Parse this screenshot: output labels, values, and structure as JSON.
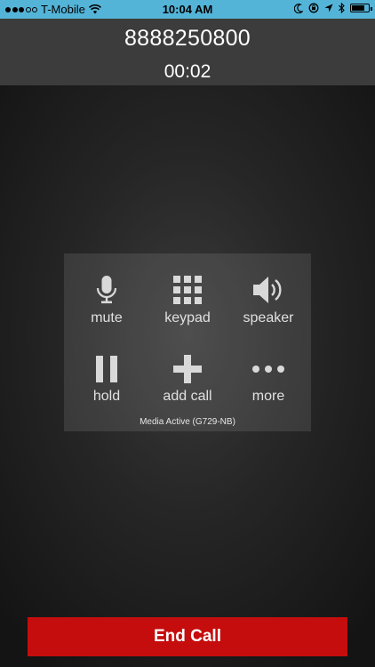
{
  "status_bar": {
    "carrier": "T-Mobile",
    "time": "10:04 AM",
    "signal_bars_filled": 3,
    "signal_bars_total": 5,
    "battery_level": 0.8,
    "icons": [
      "wifi-icon",
      "moon-icon",
      "orientation-lock-icon",
      "location-icon",
      "bluetooth-icon",
      "battery-icon"
    ]
  },
  "call": {
    "number": "8888250800",
    "duration": "00:02"
  },
  "controls": {
    "mute": "mute",
    "keypad": "keypad",
    "speaker": "speaker",
    "hold": "hold",
    "add_call": "add call",
    "more": "more",
    "media_status": "Media Active (G729-NB)"
  },
  "end_call": {
    "label": "End Call",
    "color": "#c60d0d"
  },
  "colors": {
    "status_bar_bg": "#54b4d8",
    "header_bg": "#3c3c3c"
  }
}
